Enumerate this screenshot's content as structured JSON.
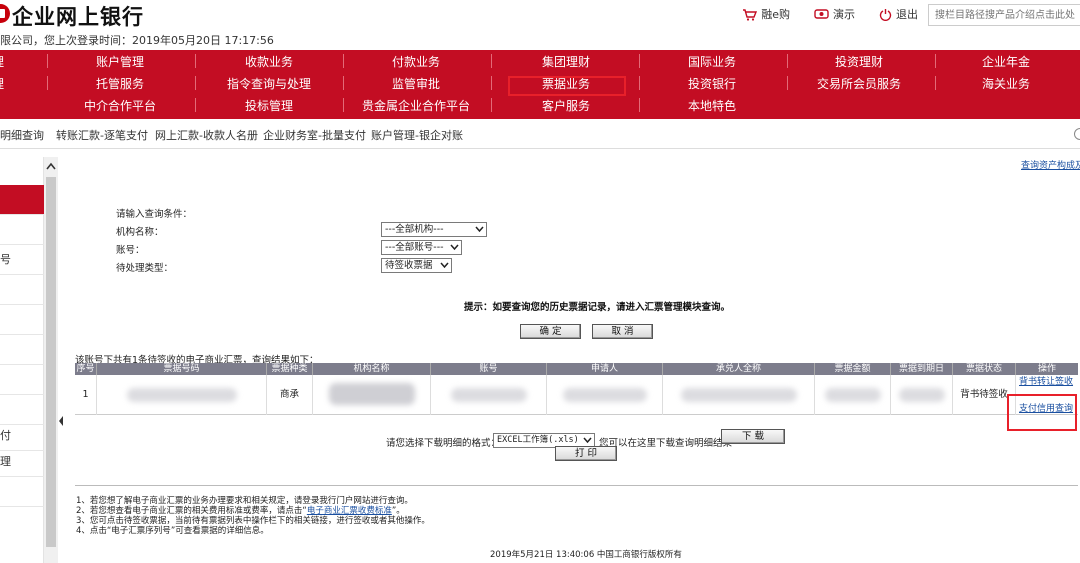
{
  "header": {
    "bank_title": "企业网上银行",
    "login_info": "限公司，您上次登录时间：2019年05月20日 17:17:56",
    "links": [
      {
        "label": "融e购",
        "icon": "cart-icon"
      },
      {
        "label": "演示",
        "icon": "eye-icon"
      },
      {
        "label": "退出",
        "icon": "power-icon"
      }
    ],
    "search_placeholder": "搜栏目路径搜产品介绍点击此处"
  },
  "nav": {
    "rows": [
      [
        "理",
        "账户管理",
        "收款业务",
        "付款业务",
        "集团理财",
        "国际业务",
        "投资理财",
        "企业年金"
      ],
      [
        "理",
        "托管服务",
        "指令查询与处理",
        "监管审批",
        "票据业务",
        "投资银行",
        "交易所会员服务",
        "海关业务"
      ],
      [
        "",
        "中介合作平台",
        "投标管理",
        "贵金属企业合作平台",
        "客户服务",
        "本地特色",
        "",
        ""
      ]
    ],
    "highlighted": "票据业务"
  },
  "subnav": {
    "items": [
      "明细查询",
      "转账汇款-逐笔支付",
      "网上汇款-收款人名册",
      "企业财务室-批量支付",
      "账户管理-银企对账"
    ]
  },
  "leftpanel": {
    "items": [
      "",
      "",
      "",
      "号",
      "",
      "",
      "",
      "",
      "",
      "付",
      "理",
      ""
    ]
  },
  "main": {
    "top_link": "查询资产构成及",
    "query_prompt": "请输入查询条件：",
    "fields": [
      {
        "label": "机构名称：",
        "value": "---全部机构---"
      },
      {
        "label": "账号：",
        "value": "---全部账号---"
      },
      {
        "label": "待处理类型：",
        "value": "待签收票据"
      }
    ],
    "tip": "提示：如要查询您的历史票据记录，请进入汇票管理模块查询。",
    "confirm_label": "确  定",
    "cancel_label": "取  消",
    "result_caption": "该账号下共有1条待签收的电子商业汇票，查询结果如下：",
    "table": {
      "headers": [
        "序号",
        "票据号码",
        "票据种类",
        "机构名称",
        "账号",
        "申请人",
        "承兑人全称",
        "票据金额",
        "票据到期日",
        "票据状态",
        "操作"
      ],
      "rows": [
        {
          "index": "1",
          "kind": "商承",
          "status": "背书待签收",
          "ops": [
            "背书转让签收",
            "支付信用查询"
          ]
        }
      ]
    },
    "download_label": "请您选择下载明细的格式：",
    "format_value": "EXCEL工作簿(.xls)",
    "download_hint": "您可以在这里下载查询明细结果",
    "download_button": "下  载",
    "print_button": "打  印",
    "notes": {
      "note1": "1、若您想了解电子商业汇票的业务办理要求和相关规定，请登录我行门户网站进行查询。",
      "note2_prefix": "2、若您想查看电子商业汇票的相关费用标准或费率，请点击“",
      "note2_link": "电子商业汇票收费标准",
      "note2_suffix": "”。",
      "note3": "3、您可点击待签收票据，当前待有票据列表中操作栏下的相关链接，进行签收或者其他操作。",
      "note4": "4、点击“电子汇票序列号”可查看票据的详细信息。"
    },
    "footer": "2019年5月21日  13:40:06     中国工商银行版权所有"
  },
  "colors": {
    "brand_red": "#c30d23",
    "highlight_red": "#e8202a",
    "table_header": "#7d7d8c",
    "link_blue": "#1a4fa0"
  }
}
